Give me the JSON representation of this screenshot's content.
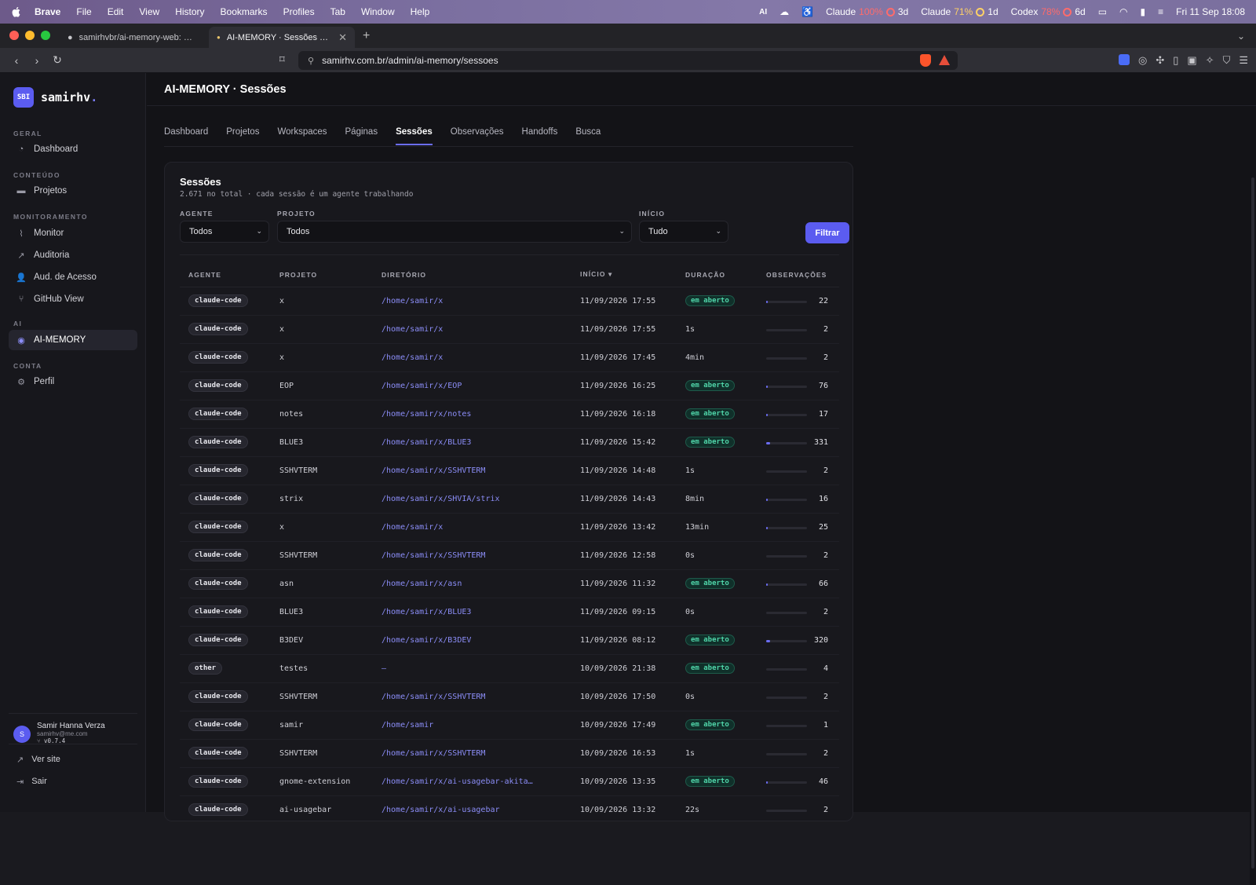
{
  "menubar": {
    "app": "Brave",
    "items": [
      "File",
      "Edit",
      "View",
      "History",
      "Bookmarks",
      "Profiles",
      "Tab",
      "Window",
      "Help"
    ],
    "status": {
      "ai": "AI",
      "claude1_label": "Claude",
      "claude1_pct": "100%",
      "claude1_time": "3d",
      "claude2_label": "Claude",
      "claude2_pct": "71%",
      "claude2_time": "1d",
      "codex_label": "Codex",
      "codex_pct": "78%",
      "codex_time": "6d",
      "datetime": "Fri 11 Sep  18:08"
    }
  },
  "browser": {
    "tabs": [
      {
        "title": "samirhvbr/ai-memory-web: Read-o"
      },
      {
        "title": "AI-MEMORY · Sessões — Samir"
      }
    ],
    "url": "samirhv.com.br/admin/ai-memory/sessoes"
  },
  "sidebar": {
    "brand_logo": "SBI",
    "brand_name": "samirhv",
    "brand_dot": ".",
    "sections": {
      "geral": "GERAL",
      "conteudo": "CONTEÚDO",
      "monitoramento": "MONITORAMENTO",
      "ai": "AI",
      "conta": "CONTA"
    },
    "items": {
      "dashboard": "Dashboard",
      "projetos": "Projetos",
      "monitor": "Monitor",
      "auditoria": "Auditoria",
      "aud_acesso": "Aud. de Acesso",
      "github": "GitHub View",
      "ai_memory": "AI-MEMORY",
      "perfil": "Perfil"
    },
    "user": {
      "initial": "S",
      "name": "Samir Hanna Verza",
      "email": "samirhv@me.com",
      "version": "v0.7.4"
    },
    "ver_site": "Ver site",
    "sair": "Sair"
  },
  "main": {
    "title": "AI-MEMORY · Sessões",
    "tabs": [
      "Dashboard",
      "Projetos",
      "Workspaces",
      "Páginas",
      "Sessões",
      "Observações",
      "Handoffs",
      "Busca"
    ],
    "active_tab": "Sessões"
  },
  "card": {
    "title": "Sessões",
    "subtitle": "2.671 no total · cada sessão é um agente trabalhando",
    "filters": {
      "agente_label": "AGENTE",
      "agente_value": "Todos",
      "projeto_label": "PROJETO",
      "projeto_value": "Todos",
      "inicio_label": "INÍCIO",
      "inicio_value": "Tudo",
      "button": "Filtrar"
    },
    "columns": {
      "agente": "AGENTE",
      "projeto": "PROJETO",
      "diretorio": "DIRETÓRIO",
      "inicio": "INÍCIO ▾",
      "duracao": "DURAÇÃO",
      "observacoes": "OBSERVAÇÕES"
    },
    "rows": [
      {
        "agent": "claude-code",
        "project": "x",
        "dir": "/home/samir/x",
        "start": "11/09/2026 17:55",
        "duration": "em aberto",
        "open": true,
        "obs": "22",
        "frac": 0.02
      },
      {
        "agent": "claude-code",
        "project": "x",
        "dir": "/home/samir/x",
        "start": "11/09/2026 17:55",
        "duration": "1s",
        "open": false,
        "obs": "2",
        "frac": 0.0
      },
      {
        "agent": "claude-code",
        "project": "x",
        "dir": "/home/samir/x",
        "start": "11/09/2026 17:45",
        "duration": "4min",
        "open": false,
        "obs": "2",
        "frac": 0.0
      },
      {
        "agent": "claude-code",
        "project": "EOP",
        "dir": "/home/samir/x/EOP",
        "start": "11/09/2026 16:25",
        "duration": "em aberto",
        "open": true,
        "obs": "76",
        "frac": 0.03
      },
      {
        "agent": "claude-code",
        "project": "notes",
        "dir": "/home/samir/x/notes",
        "start": "11/09/2026 16:18",
        "duration": "em aberto",
        "open": true,
        "obs": "17",
        "frac": 0.01
      },
      {
        "agent": "claude-code",
        "project": "BLUE3",
        "dir": "/home/samir/x/BLUE3",
        "start": "11/09/2026 15:42",
        "duration": "em aberto",
        "open": true,
        "obs": "331",
        "frac": 0.1
      },
      {
        "agent": "claude-code",
        "project": "SSHVTERM",
        "dir": "/home/samir/x/SSHVTERM",
        "start": "11/09/2026 14:48",
        "duration": "1s",
        "open": false,
        "obs": "2",
        "frac": 0.0
      },
      {
        "agent": "claude-code",
        "project": "strix",
        "dir": "/home/samir/x/SHVIA/strix",
        "start": "11/09/2026 14:43",
        "duration": "8min",
        "open": false,
        "obs": "16",
        "frac": 0.01
      },
      {
        "agent": "claude-code",
        "project": "x",
        "dir": "/home/samir/x",
        "start": "11/09/2026 13:42",
        "duration": "13min",
        "open": false,
        "obs": "25",
        "frac": 0.02
      },
      {
        "agent": "claude-code",
        "project": "SSHVTERM",
        "dir": "/home/samir/x/SSHVTERM",
        "start": "11/09/2026 12:58",
        "duration": "0s",
        "open": false,
        "obs": "2",
        "frac": 0.0
      },
      {
        "agent": "claude-code",
        "project": "asn",
        "dir": "/home/samir/x/asn",
        "start": "11/09/2026 11:32",
        "duration": "em aberto",
        "open": true,
        "obs": "66",
        "frac": 0.03
      },
      {
        "agent": "claude-code",
        "project": "BLUE3",
        "dir": "/home/samir/x/BLUE3",
        "start": "11/09/2026 09:15",
        "duration": "0s",
        "open": false,
        "obs": "2",
        "frac": 0.0
      },
      {
        "agent": "claude-code",
        "project": "B3DEV",
        "dir": "/home/samir/x/B3DEV",
        "start": "11/09/2026 08:12",
        "duration": "em aberto",
        "open": true,
        "obs": "320",
        "frac": 0.1
      },
      {
        "agent": "other",
        "project": "testes",
        "dir": "—",
        "start": "10/09/2026 21:38",
        "duration": "em aberto",
        "open": true,
        "obs": "4",
        "frac": 0.0
      },
      {
        "agent": "claude-code",
        "project": "SSHVTERM",
        "dir": "/home/samir/x/SSHVTERM",
        "start": "10/09/2026 17:50",
        "duration": "0s",
        "open": false,
        "obs": "2",
        "frac": 0.0
      },
      {
        "agent": "claude-code",
        "project": "samir",
        "dir": "/home/samir",
        "start": "10/09/2026 17:49",
        "duration": "em aberto",
        "open": true,
        "obs": "1",
        "frac": 0.0
      },
      {
        "agent": "claude-code",
        "project": "SSHVTERM",
        "dir": "/home/samir/x/SSHVTERM",
        "start": "10/09/2026 16:53",
        "duration": "1s",
        "open": false,
        "obs": "2",
        "frac": 0.0
      },
      {
        "agent": "claude-code",
        "project": "gnome-extension",
        "dir": "/home/samir/x/ai-usagebar-akita…",
        "start": "10/09/2026 13:35",
        "duration": "em aberto",
        "open": true,
        "obs": "46",
        "frac": 0.02
      },
      {
        "agent": "claude-code",
        "project": "ai-usagebar",
        "dir": "/home/samir/x/ai-usagebar",
        "start": "10/09/2026 13:32",
        "duration": "22s",
        "open": false,
        "obs": "2",
        "frac": 0.0
      }
    ]
  },
  "colors": {
    "accent": "#5b5cf0",
    "open_badge": "#4fd4a8",
    "dir_link": "#8b8df7"
  }
}
